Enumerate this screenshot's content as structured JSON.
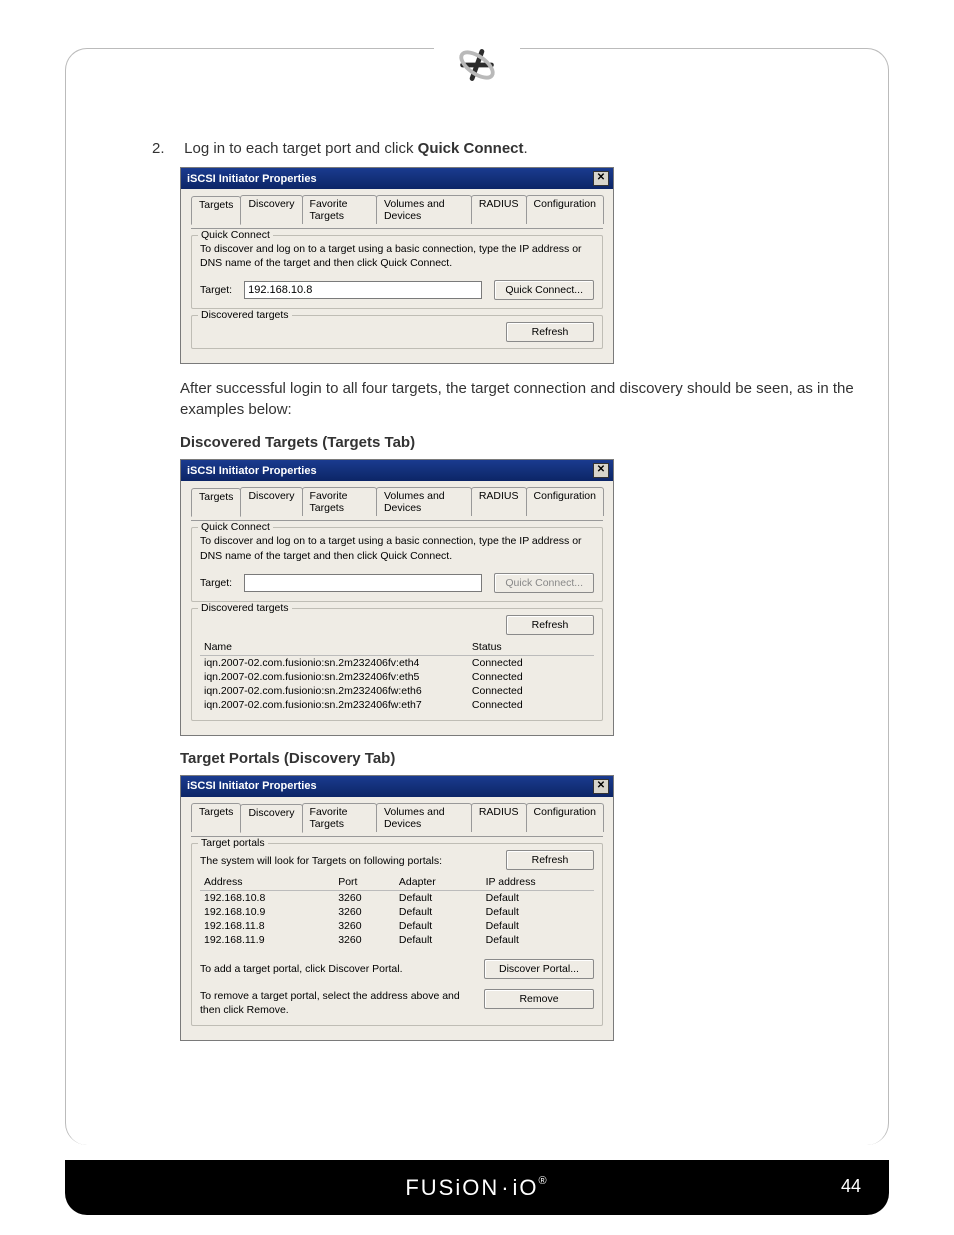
{
  "step": {
    "num": "2.",
    "text_pre": "Log in to each target port and click ",
    "bold": "Quick Connect",
    "text_post": "."
  },
  "paragraph_after": "After successful login to all four targets, the target connection and discovery should be seen, as in the examples below:",
  "heading_discovered": "Discovered Targets (Targets Tab)",
  "heading_portals": "Target Portals (Discovery Tab)",
  "dlg": {
    "title": "iSCSI Initiator Properties",
    "close_glyph": "✕",
    "tabs": [
      "Targets",
      "Discovery",
      "Favorite Targets",
      "Volumes and Devices",
      "RADIUS",
      "Configuration"
    ],
    "qc_title": "Quick Connect",
    "qc_desc": "To discover and log on to a target using a basic connection, type the IP address or DNS name of the target and then click Quick Connect.",
    "target_label": "Target:",
    "target_value_1": "192.168.10.8",
    "target_value_2": "",
    "btn_quick_connect": "Quick Connect...",
    "dt_title": "Discovered targets",
    "btn_refresh": "Refresh",
    "col_name": "Name",
    "col_status": "Status",
    "targets": [
      {
        "name": "iqn.2007-02.com.fusionio:sn.2m232406fv:eth4",
        "status": "Connected"
      },
      {
        "name": "iqn.2007-02.com.fusionio:sn.2m232406fv:eth5",
        "status": "Connected"
      },
      {
        "name": "iqn.2007-02.com.fusionio:sn.2m232406fw:eth6",
        "status": "Connected"
      },
      {
        "name": "iqn.2007-02.com.fusionio:sn.2m232406fw:eth7",
        "status": "Connected"
      }
    ]
  },
  "dlg3": {
    "tp_title": "Target portals",
    "tp_desc": "The system will look for Targets on following portals:",
    "col_addr": "Address",
    "col_port": "Port",
    "col_adapter": "Adapter",
    "col_ip": "IP address",
    "rows": [
      {
        "addr": "192.168.10.8",
        "port": "3260",
        "adapter": "Default",
        "ip": "Default"
      },
      {
        "addr": "192.168.10.9",
        "port": "3260",
        "adapter": "Default",
        "ip": "Default"
      },
      {
        "addr": "192.168.11.8",
        "port": "3260",
        "adapter": "Default",
        "ip": "Default"
      },
      {
        "addr": "192.168.11.9",
        "port": "3260",
        "adapter": "Default",
        "ip": "Default"
      }
    ],
    "add_text": "To add a target portal, click Discover Portal.",
    "remove_text": "To remove a target portal, select the address above and then click Remove.",
    "btn_discover": "Discover Portal...",
    "btn_remove": "Remove"
  },
  "footer": {
    "brand": "FUSiON-iO",
    "page": "44"
  }
}
